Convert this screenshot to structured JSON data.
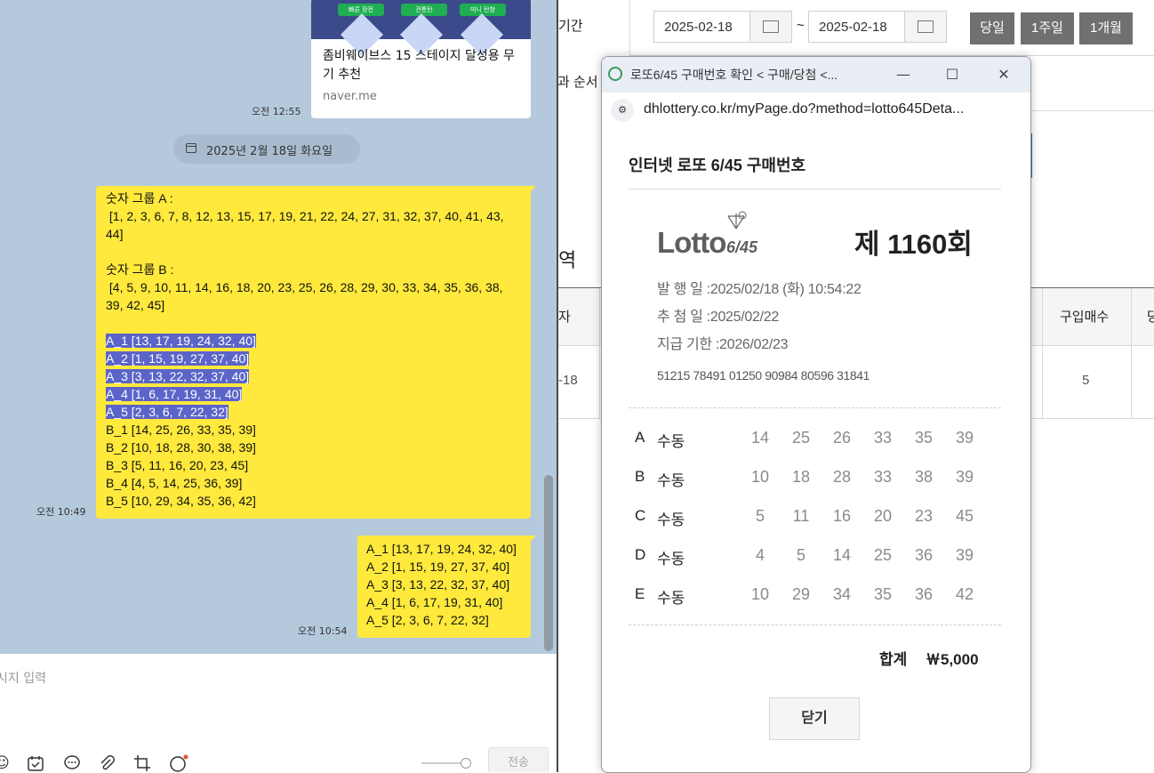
{
  "chat": {
    "link_card": {
      "thumb_labels": [
        "빠른 장전",
        "관통탄",
        "미니 탄창"
      ],
      "title": "좀비웨이브스 15 스테이지 달성용 무기 추천",
      "domain": "naver.me",
      "time": "오전 12:55"
    },
    "date_divider": "2025년 2월 18일 화요일",
    "message1": {
      "lines": [
        "숫자 그룹 A :",
        " [1, 2, 3, 6, 7, 8, 12, 13, 15, 17, 19, 21, 22, 24, 27, 31, 32, 37, 40, 41, 43,",
        "44]",
        "",
        "숫자 그룹 B :",
        " [4, 5, 9, 10, 11, 14, 16, 18, 20, 23, 25, 26, 28, 29, 30, 33, 34, 35, 36, 38,",
        "39, 42, 45]",
        "",
        "A_1 [13, 17, 19, 24, 32, 40]",
        "A_2 [1, 15, 19, 27, 37, 40]",
        "A_3 [3, 13, 22, 32, 37, 40]",
        "A_4 [1, 6, 17, 19, 31, 40]",
        "A_5 [2, 3, 6, 7, 22, 32]",
        "B_1 [14, 25, 26, 33, 35, 39]",
        "B_2 [10, 18, 28, 30, 38, 39]",
        "B_3 [5, 11, 16, 20, 23, 45]",
        "B_4 [4, 5, 14, 25, 36, 39]",
        "B_5 [10, 29, 34, 35, 36, 42]"
      ],
      "time": "오전 10:49"
    },
    "message2": {
      "lines": [
        "A_1 [13, 17, 19, 24, 32, 40]",
        "A_2 [1, 15, 19, 27, 37, 40]",
        "A_3 [3, 13, 22, 32, 37, 40]",
        "A_4 [1, 6, 17, 19, 31, 40]",
        "A_5 [2, 3, 6, 7, 22, 32]"
      ],
      "time": "오전 10:54"
    },
    "input_placeholder": "시지 입력",
    "send_label": "전송",
    "toolbar_icons": [
      "emoji-icon",
      "calendar-check-icon",
      "speech-bubble-icon",
      "paperclip-icon",
      "crop-icon",
      "font-icon"
    ]
  },
  "bgpage": {
    "label_period": "기간",
    "label_order": "과 순서",
    "date_from": "2025-02-18",
    "tilde": "~",
    "date_to": "2025-02-18",
    "btn_today": "당일",
    "btn_week": "1주일",
    "btn_month": "1개월",
    "section_fragment": "역",
    "col_fragment": "자",
    "col_qty": "구입매수",
    "col_next": "당",
    "row_date_fragment": "-18",
    "row_qty": "5"
  },
  "popup": {
    "window_title": "로또6/45 구매번호 확인 < 구매/당첨 <...",
    "url": "dhlottery.co.kr/myPage.do?method=lotto645Deta...",
    "heading": "인터넷 로또 6/45 구매번호",
    "logo_main": "Lotto",
    "logo_sub": "6/45",
    "draw_no": "제 1160회",
    "issue_label": "발 행 일 :",
    "issue_value": "2025/02/18 (화) 10:54:22",
    "draw_label": "추 첨 일 :",
    "draw_value": "2025/02/22",
    "deadline_label": "지급 기한 :",
    "deadline_value": "2026/02/23",
    "barcode": "51215 78491 01250 90984 80596 31841",
    "games": [
      {
        "letter": "A",
        "mode": "수동",
        "numbers": [
          "14",
          "25",
          "26",
          "33",
          "35",
          "39"
        ]
      },
      {
        "letter": "B",
        "mode": "수동",
        "numbers": [
          "10",
          "18",
          "28",
          "33",
          "38",
          "39"
        ]
      },
      {
        "letter": "C",
        "mode": "수동",
        "numbers": [
          "5",
          "11",
          "16",
          "20",
          "23",
          "45"
        ]
      },
      {
        "letter": "D",
        "mode": "수동",
        "numbers": [
          "4",
          "5",
          "14",
          "25",
          "36",
          "39"
        ]
      },
      {
        "letter": "E",
        "mode": "수동",
        "numbers": [
          "10",
          "29",
          "34",
          "35",
          "36",
          "42"
        ]
      }
    ],
    "total_label": "합계",
    "total_value": "￦5,000",
    "close_label": "닫기"
  }
}
